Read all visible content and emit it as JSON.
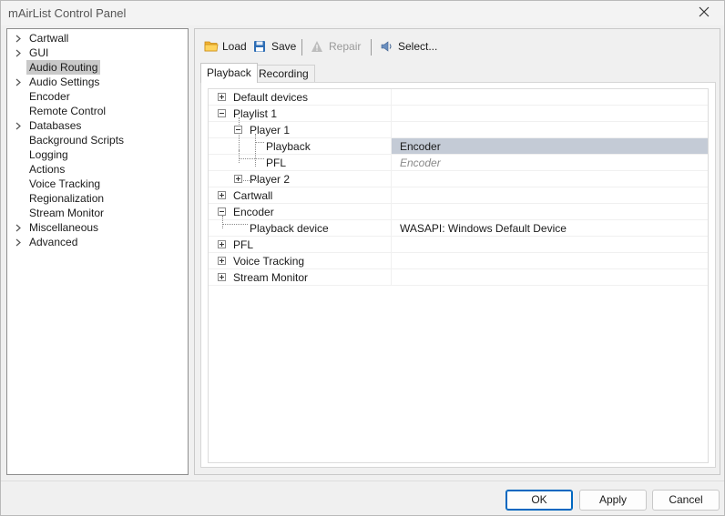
{
  "window": {
    "title": "mAirList Control Panel"
  },
  "nav": {
    "items": [
      {
        "label": "Cartwall",
        "expandable": true
      },
      {
        "label": "GUI",
        "expandable": true
      },
      {
        "label": "Audio Routing",
        "expandable": false,
        "selected": true
      },
      {
        "label": "Audio Settings",
        "expandable": true
      },
      {
        "label": "Encoder",
        "expandable": false
      },
      {
        "label": "Remote Control",
        "expandable": false
      },
      {
        "label": "Databases",
        "expandable": true
      },
      {
        "label": "Background Scripts",
        "expandable": false
      },
      {
        "label": "Logging",
        "expandable": false
      },
      {
        "label": "Actions",
        "expandable": false
      },
      {
        "label": "Voice Tracking",
        "expandable": false
      },
      {
        "label": "Regionalization",
        "expandable": false
      },
      {
        "label": "Stream Monitor",
        "expandable": false
      },
      {
        "label": "Miscellaneous",
        "expandable": true
      },
      {
        "label": "Advanced",
        "expandable": true
      }
    ]
  },
  "toolbar": {
    "load": "Load",
    "save": "Save",
    "repair": "Repair",
    "select": "Select..."
  },
  "tabs": [
    {
      "label": "Playback",
      "active": true
    },
    {
      "label": "Recording",
      "active": false
    }
  ],
  "routing": {
    "rows": [
      {
        "name": "Default devices",
        "value": "",
        "level": 0,
        "state": "collapsed"
      },
      {
        "name": "Playlist 1",
        "value": "",
        "level": 0,
        "state": "expanded"
      },
      {
        "name": "Player 1",
        "value": "",
        "level": 1,
        "state": "expanded"
      },
      {
        "name": "Playback",
        "value": "Encoder",
        "level": 2,
        "state": "leaf",
        "selected": true
      },
      {
        "name": "PFL",
        "value": "Encoder",
        "level": 2,
        "state": "leaf",
        "inherited": true
      },
      {
        "name": "Player 2",
        "value": "",
        "level": 1,
        "state": "collapsed"
      },
      {
        "name": "Cartwall",
        "value": "",
        "level": 0,
        "state": "collapsed"
      },
      {
        "name": "Encoder",
        "value": "",
        "level": 0,
        "state": "expanded"
      },
      {
        "name": "Playback device",
        "value": "WASAPI: Windows Default Device",
        "level": 1,
        "state": "leaf"
      },
      {
        "name": "PFL",
        "value": "",
        "level": 0,
        "state": "collapsed"
      },
      {
        "name": "Voice Tracking",
        "value": "",
        "level": 0,
        "state": "collapsed"
      },
      {
        "name": "Stream Monitor",
        "value": "",
        "level": 0,
        "state": "collapsed"
      }
    ]
  },
  "footer": {
    "ok": "OK",
    "apply": "Apply",
    "cancel": "Cancel"
  },
  "colors": {
    "selection_nav": "#c9c9c9",
    "selection_cell": "#c4cbd6",
    "default_button": "#0067c0"
  }
}
